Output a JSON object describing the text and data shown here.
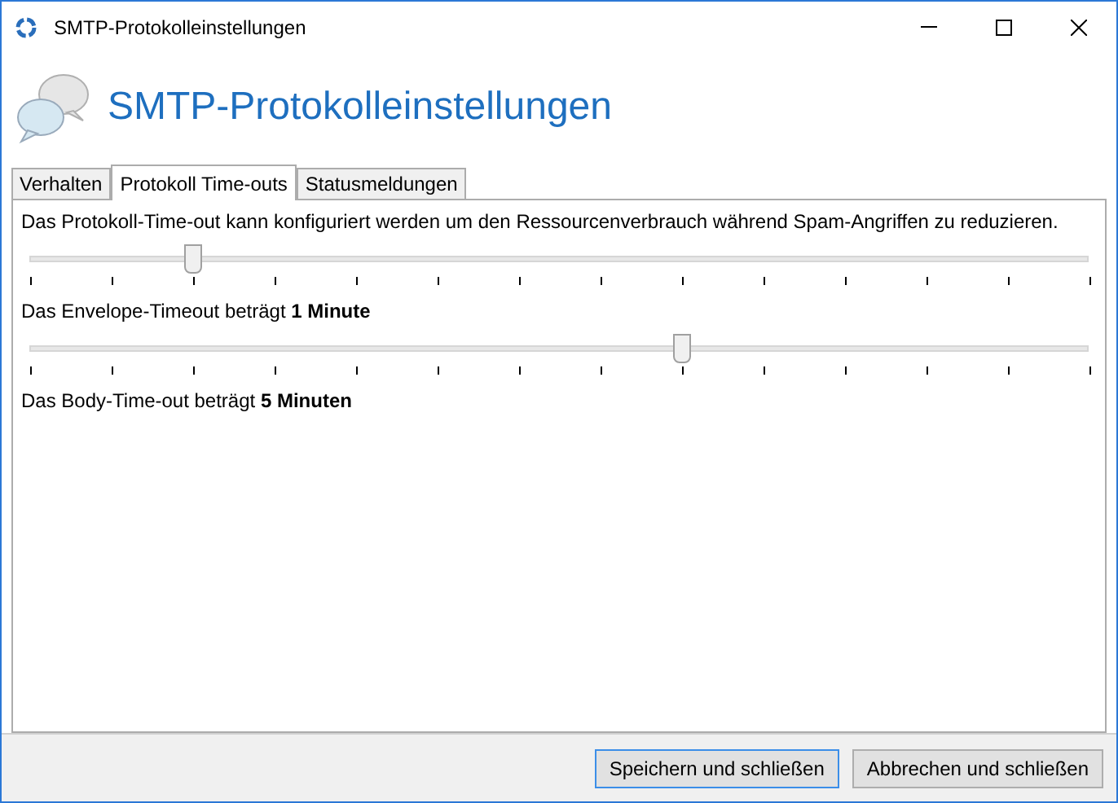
{
  "window": {
    "title": "SMTP-Protokolleinstellungen"
  },
  "header": {
    "title": "SMTP-Protokolleinstellungen"
  },
  "tabs": [
    {
      "label": "Verhalten",
      "selected": false
    },
    {
      "label": "Protokoll Time-outs",
      "selected": true
    },
    {
      "label": "Statusmeldungen",
      "selected": false
    }
  ],
  "description": "Das Protokoll-Time-out kann konfiguriert werden um den Ressourcenverbrauch während Spam-Angriffen zu reduzieren.",
  "sliders": [
    {
      "level": 0.1538,
      "caption": "Das Envelope-Timeout beträgt **1 Minute**"
    },
    {
      "level": 0.6154,
      "caption": "Das Body-Time-out beträgt **5 Minuten**"
    }
  ],
  "buttons": [
    {
      "label": "Speichern und schließen",
      "selected": true
    },
    {
      "label": "Abbrechen und schließen",
      "selected": false
    }
  ]
}
